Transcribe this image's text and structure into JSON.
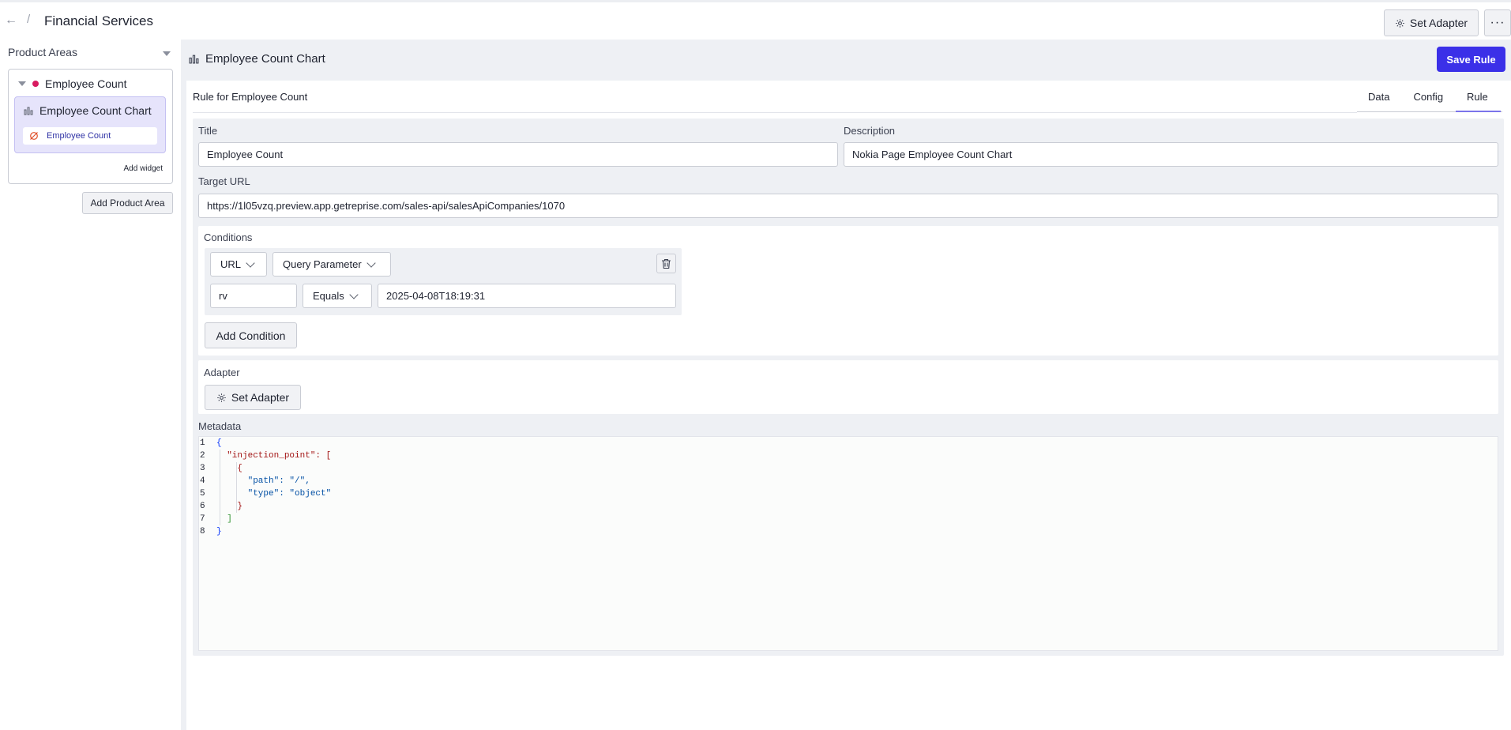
{
  "header": {
    "back_icon": "arrow-left-icon",
    "separator": "/",
    "title": "Financial Services",
    "set_adapter_label": "Set Adapter",
    "more_label": "···"
  },
  "sidebar": {
    "section_label": "Product Areas",
    "area": {
      "name": "Employee Count",
      "dot_color": "#d81b60",
      "widget": {
        "name": "Employee Count Chart",
        "rule_name": "Employee Count"
      },
      "add_widget_label": "Add widget"
    },
    "add_product_area_label": "Add Product Area"
  },
  "main": {
    "title": "Employee Count Chart",
    "save_rule_label": "Save Rule",
    "accent_color": "#3b30e8",
    "rule_for": "Rule for Employee Count",
    "tabs": [
      {
        "label": "Data",
        "active": false
      },
      {
        "label": "Config",
        "active": false
      },
      {
        "label": "Rule",
        "active": true
      }
    ],
    "form": {
      "title_label": "Title",
      "title_value": "Employee Count",
      "description_label": "Description",
      "description_value": "Nokia Page Employee Count Chart",
      "target_url_label": "Target URL",
      "target_url_value": "https://1l05vzq.preview.app.getreprise.com/sales-api/salesApiCompanies/1070",
      "conditions_label": "Conditions",
      "condition": {
        "source": "URL",
        "type": "Query Parameter",
        "key": "rv",
        "operator": "Equals",
        "value": "2025-04-08T18:19:31"
      },
      "add_condition_label": "Add Condition",
      "adapter_label": "Adapter",
      "set_adapter_label": "Set Adapter",
      "metadata_label": "Metadata",
      "metadata_lines": [
        {
          "n": "1",
          "text": "{"
        },
        {
          "n": "2",
          "text": "  \"injection_point\": ["
        },
        {
          "n": "3",
          "text": "    {"
        },
        {
          "n": "4",
          "text": "      \"path\": \"/\","
        },
        {
          "n": "5",
          "text": "      \"type\": \"object\""
        },
        {
          "n": "6",
          "text": "    }"
        },
        {
          "n": "7",
          "text": "  ]"
        },
        {
          "n": "8",
          "text": "}"
        }
      ]
    }
  }
}
